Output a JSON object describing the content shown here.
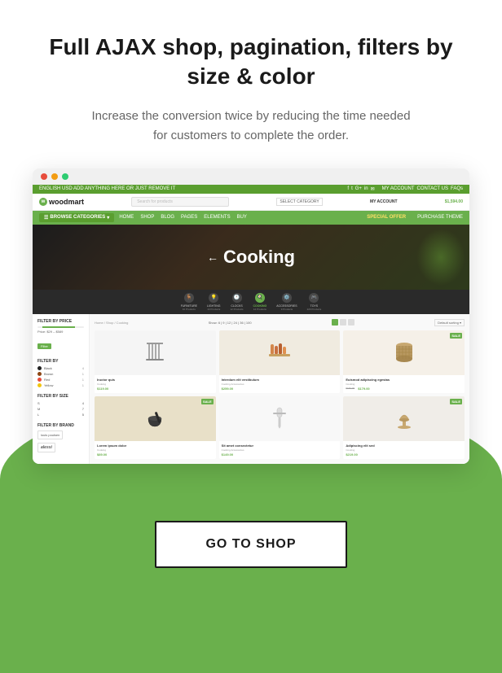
{
  "page": {
    "title": "Full AJAX shop, pagination, filters by size & color",
    "subtitle": "Increase the conversion twice by reducing the time needed for customers to complete the order.",
    "cta_button": "GO TO SHOP"
  },
  "browser": {
    "dots": [
      "#e74c3c",
      "#f39c12",
      "#2ecc71"
    ]
  },
  "shop": {
    "top_bar_text": "ENGLISH  USD  ADD ANYTHING HERE OR JUST REMOVE IT",
    "logo": "woodmart",
    "search_placeholder": "Search for products",
    "select_category": "SELECT CATEGORY",
    "my_account": "MY ACCOUNT",
    "cart_total": "$1,594.00",
    "browse_categories": "BROWSE CATEGORIES",
    "nav_items": [
      "HOME",
      "SHOP",
      "BLOG",
      "PAGES",
      "ELEMENTS",
      "BUY"
    ],
    "special_offer": "SPECIAL OFFER",
    "purchase_theme": "PURCHASE THEME",
    "hero_title": "Cooking",
    "categories": [
      {
        "name": "FURNITURE",
        "count": "10 Products"
      },
      {
        "name": "LIGHTING",
        "count": "14 Products"
      },
      {
        "name": "CLOCKS",
        "count": "12 Products"
      },
      {
        "name": "COOKING",
        "count": "12 Products"
      },
      {
        "name": "ACCESSORIES",
        "count": "9 Products"
      },
      {
        "name": "TOYS",
        "count": "220 Products"
      }
    ],
    "breadcrumb": "Home / Shop / Cooking",
    "show_label": "Show:",
    "show_options": [
      "6",
      "9",
      "12",
      "24",
      "36",
      "100"
    ],
    "default_sorting": "Default sorting",
    "sidebar": {
      "filter_by_price": "FILTER BY PRICE",
      "price_range": "Price: $29 – $589",
      "filter_btn": "Filter",
      "filter_by": "FILTER BY",
      "colors": [
        {
          "name": "Black",
          "count": "4",
          "hex": "#222"
        },
        {
          "name": "Brown",
          "count": "1",
          "hex": "#8B4513"
        },
        {
          "name": "Red",
          "count": "1",
          "hex": "#e74c3c"
        },
        {
          "name": "Yellow",
          "count": "1",
          "hex": "#f1c40f"
        }
      ],
      "filter_by_size": "FILTER BY SIZE",
      "sizes": [
        {
          "label": "S",
          "count": "4"
        },
        {
          "label": "M",
          "count": "7"
        },
        {
          "label": "L",
          "count": "5"
        }
      ],
      "filter_by_brand": "FILTER BY BRAND",
      "brands": [
        "louis poulsen",
        "alessi"
      ]
    },
    "products": [
      {
        "name": "Iructor quis",
        "category": "Cooking",
        "price": "$119.00",
        "old_price": null,
        "sale": false,
        "color": "#c8c0b0"
      },
      {
        "name": "Interdum elit vestibulum",
        "category": "Cooking Accessories",
        "price": "$259.00",
        "old_price": null,
        "sale": false,
        "color": "#d4a050"
      },
      {
        "name": "Euismod adipiscing egestas",
        "category": "Cooking",
        "price": "$179.00",
        "old_price": "$187.00",
        "sale": true,
        "color": "#b8a070"
      },
      {
        "name": "Lorem ipsum dolor",
        "category": "Cooking",
        "price": "$89.00",
        "old_price": null,
        "sale": true,
        "color": "#c8b040"
      },
      {
        "name": "Sit amet consectetur",
        "category": "Cooking Accessories",
        "price": "$149.00",
        "old_price": null,
        "sale": false,
        "color": "#e8e8e8"
      },
      {
        "name": "Adipiscing elit sed",
        "category": "Cooking",
        "price": "$219.00",
        "old_price": null,
        "sale": true,
        "color": "#c8a060"
      }
    ]
  }
}
